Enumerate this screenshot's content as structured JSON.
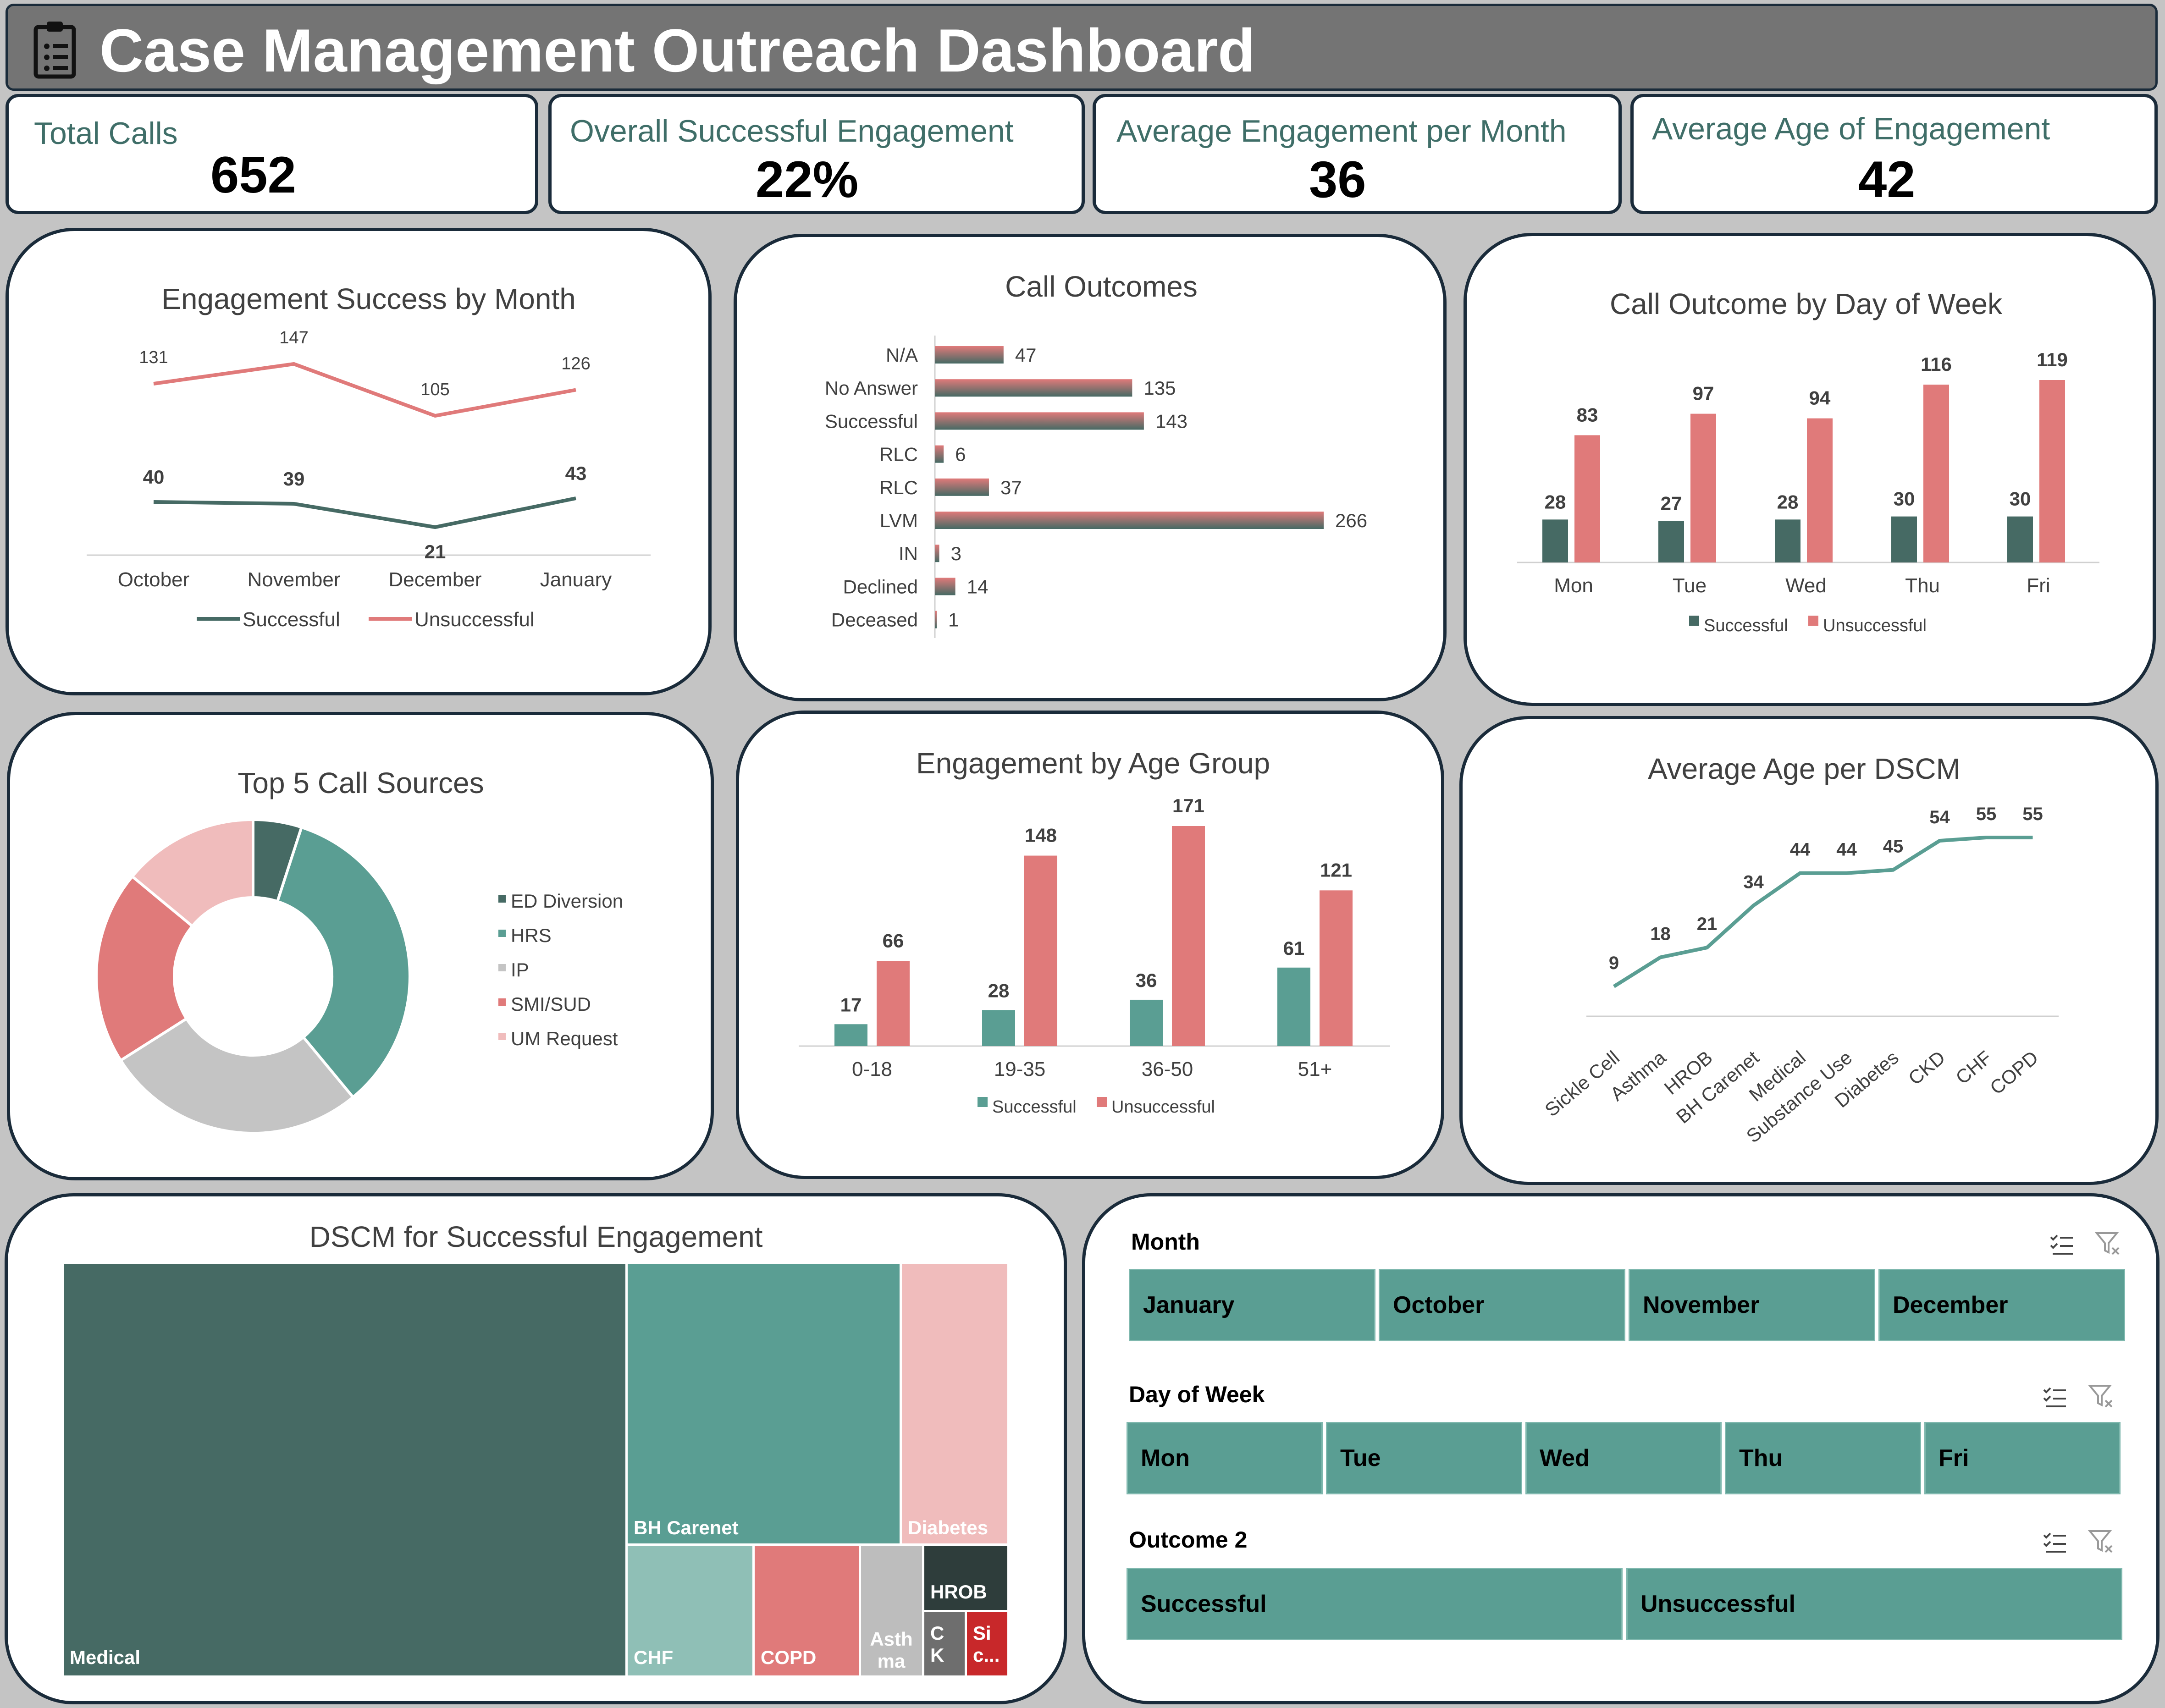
{
  "header": {
    "title": "Case Management Outreach Dashboard",
    "icon": "clipboard-icon"
  },
  "kpis": [
    {
      "label": "Total Calls",
      "value": "652"
    },
    {
      "label": "Overall Successful Engagement",
      "value": "22%"
    },
    {
      "label": "Average Engagement per Month",
      "value": "36"
    },
    {
      "label": "Average Age of Engagement",
      "value": "42"
    }
  ],
  "colors": {
    "successful": "#466a64",
    "teal": "#5a9e93",
    "unsuccessful": "#e07a7a",
    "grey": "#c4c4c4",
    "pink": "#f0bcbc",
    "dark": "#1a2b3a"
  },
  "charts": {
    "month": {
      "title": "Engagement Success by Month"
    },
    "outcomes": {
      "title": "Call Outcomes"
    },
    "dow": {
      "title": "Call Outcome by Day of Week"
    },
    "sources": {
      "title": "Top 5 Call Sources"
    },
    "age": {
      "title": "Engagement by Age Group"
    },
    "dscm_age": {
      "title": "Average Age per DSCM"
    },
    "treemap": {
      "title": "DSCM for Successful Engagement"
    }
  },
  "chart_data": [
    {
      "id": "month",
      "type": "line",
      "title": "Engagement Success by Month",
      "categories": [
        "October",
        "November",
        "December",
        "January"
      ],
      "series": [
        {
          "name": "Successful",
          "values": [
            40,
            39,
            21,
            43
          ]
        },
        {
          "name": "Unsuccessful",
          "values": [
            131,
            147,
            105,
            126
          ]
        }
      ],
      "legend": "bottom"
    },
    {
      "id": "outcomes",
      "type": "bar",
      "orientation": "horizontal",
      "title": "Call Outcomes",
      "categories": [
        "N/A",
        "No Answer",
        "Successful",
        "RLC",
        "RLC",
        "LVM",
        "IN",
        "Declined",
        "Deceased"
      ],
      "values": [
        47,
        135,
        143,
        6,
        37,
        266,
        3,
        14,
        1
      ]
    },
    {
      "id": "dow",
      "type": "bar",
      "title": "Call Outcome by Day of Week",
      "categories": [
        "Mon",
        "Tue",
        "Wed",
        "Thu",
        "Fri"
      ],
      "series": [
        {
          "name": "Successful",
          "values": [
            28,
            27,
            28,
            30,
            30
          ]
        },
        {
          "name": "Unsuccessful",
          "values": [
            83,
            97,
            94,
            116,
            119
          ]
        }
      ],
      "legend": "bottom"
    },
    {
      "id": "sources",
      "type": "pie",
      "title": "Top 5 Call Sources",
      "categories": [
        "ED Diversion",
        "HRS",
        "IP",
        "SMI/SUD",
        "UM Request"
      ],
      "values": [
        5,
        34,
        27,
        20,
        14
      ],
      "legend": "right"
    },
    {
      "id": "age",
      "type": "bar",
      "title": "Engagement by Age Group",
      "categories": [
        "0-18",
        "19-35",
        "36-50",
        "51+"
      ],
      "series": [
        {
          "name": "Successful",
          "values": [
            17,
            28,
            36,
            61
          ]
        },
        {
          "name": "Unsuccessful",
          "values": [
            66,
            148,
            171,
            121
          ]
        }
      ],
      "legend": "bottom"
    },
    {
      "id": "dscm_age",
      "type": "line",
      "title": "Average Age per DSCM",
      "categories": [
        "Sickle Cell",
        "Asthma",
        "HROB",
        "BH Carenet",
        "Medical",
        "Substance Use",
        "Diabetes",
        "CKD",
        "CHF",
        "COPD"
      ],
      "values": [
        9,
        18,
        21,
        34,
        44,
        44,
        45,
        54,
        55,
        55
      ]
    },
    {
      "id": "treemap",
      "type": "treemap",
      "title": "DSCM for Successful Engagement",
      "categories": [
        "Medical",
        "BH Carenet",
        "Diabetes",
        "CHF",
        "COPD",
        "Asth ma",
        "HROB",
        "C K",
        "Si c..."
      ],
      "values": [
        50,
        16,
        6,
        5,
        4,
        2,
        2,
        1,
        1
      ]
    }
  ],
  "slicers": [
    {
      "title": "Month",
      "items": [
        "January",
        "October",
        "November",
        "December"
      ]
    },
    {
      "title": "Day of Week",
      "items": [
        "Mon",
        "Tue",
        "Wed",
        "Thu",
        "Fri"
      ]
    },
    {
      "title": "Outcome 2",
      "items": [
        "Successful",
        "Unsuccessful"
      ]
    }
  ]
}
